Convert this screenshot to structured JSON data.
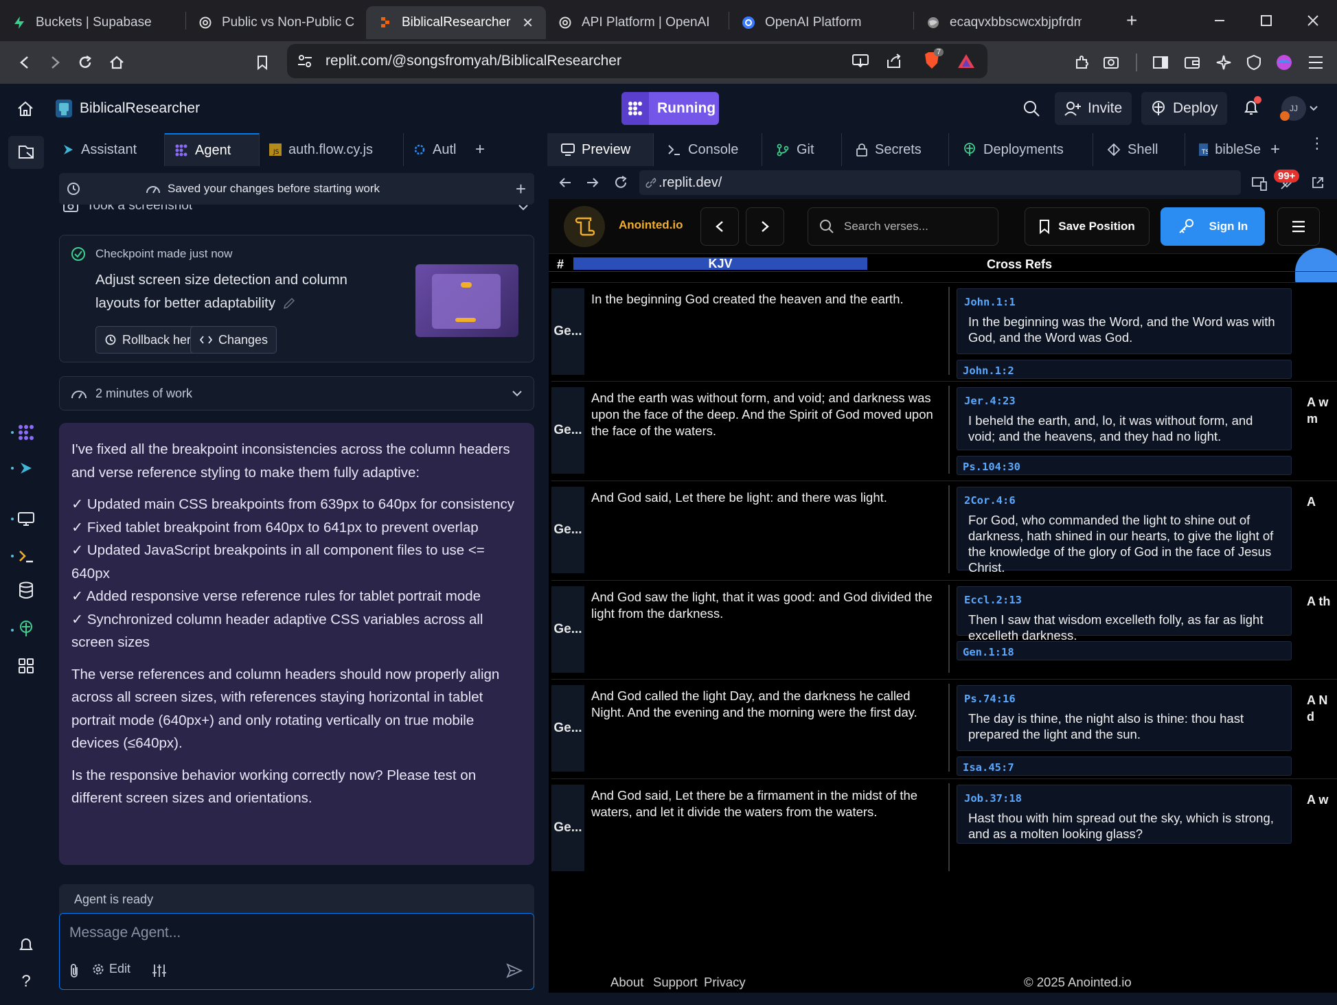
{
  "browser": {
    "tabs": [
      {
        "label": "Buckets | Supabase",
        "icon": "supabase-icon"
      },
      {
        "label": "Public vs Non-Public Cor",
        "icon": "openai-icon"
      },
      {
        "label": "BiblicalResearcher - ",
        "icon": "replit-icon",
        "active": true
      },
      {
        "label": "API Platform | OpenAI",
        "icon": "openai-icon"
      },
      {
        "label": "OpenAI Platform",
        "icon": "openai-platform-icon"
      },
      {
        "label": "ecaqvxbbscwcxbjpfrdm.s",
        "icon": "globe-icon"
      }
    ],
    "url": "replit.com/@songsfromyah/BiblicalResearcher",
    "shield_count": "7"
  },
  "replit": {
    "project_name": "BiblicalResearcher",
    "run_label": "Running",
    "invite_label": "Invite",
    "deploy_label": "Deploy",
    "avatar_initials": "JJ"
  },
  "left_pane": {
    "tabs": [
      {
        "label": "Assistant"
      },
      {
        "label": "Agent",
        "active": true
      },
      {
        "label": "auth.flow.cy.js"
      },
      {
        "label": "Autl"
      }
    ],
    "saved_bar": "Saved your changes before starting work",
    "screenshot_label": "Took a screenshot",
    "checkpoint": {
      "status": "Checkpoint made just now",
      "title_line1": "Adjust screen size detection and column",
      "title_line2": "layouts for better adaptability",
      "rollback_label": "Rollback here",
      "changes_label": "Changes"
    },
    "work_time": "2 minutes of work",
    "message": {
      "intro": "I've fixed all the breakpoint inconsistencies across the column headers and verse reference styling to make them fully adaptive:",
      "bullets": [
        "✓ Updated main CSS breakpoints from 639px to 640px for consistency",
        "✓ Fixed tablet breakpoint from 640px to 641px to prevent overlap",
        "✓ Updated JavaScript breakpoints in all component files to use <= 640px",
        "✓ Added responsive verse reference rules for tablet portrait mode",
        "✓ Synchronized column header adaptive CSS variables across all screen sizes"
      ],
      "para2": "The verse references and column headers should now properly align across all screen sizes, with references staying horizontal in tablet portrait mode (640px+) and only rotating vertically on true mobile devices (≤640px).",
      "para3": "Is the responsive behavior working correctly now? Please test on different screen sizes and orientations."
    },
    "agent_status": "Agent is ready",
    "composer_placeholder": "Message Agent...",
    "edit_label": "Edit"
  },
  "right_pane": {
    "tabs": [
      {
        "label": "Preview",
        "active": true
      },
      {
        "label": "Console"
      },
      {
        "label": "Git"
      },
      {
        "label": "Secrets"
      },
      {
        "label": "Deployments"
      },
      {
        "label": "Shell"
      },
      {
        "label": "bibleSe"
      }
    ],
    "preview_url": ".replit.dev/",
    "notification_badge": "99+"
  },
  "webapp": {
    "brand": "Anointed.io",
    "search_placeholder": "Search verses...",
    "save_position_label": "Save Position",
    "sign_in_label": "Sign In",
    "colors": {
      "accent": "#2b8cf2",
      "kjv_header": "#2a4fb8",
      "ref_link": "#5aa9ff",
      "brand": "#f2b02a"
    },
    "columns": {
      "num": "#",
      "kjv": "KJV",
      "xrefs": "Cross Refs"
    },
    "rows": [
      {
        "ref": "Ge...",
        "text": "In the beginning God created the heaven and the earth.",
        "xref": "John.1:1",
        "xref_text": "In the beginning was the Word, and the Word was with God, and the Word was God.",
        "next_ref": "John.1:2",
        "edge": ""
      },
      {
        "ref": "Ge...",
        "text": "And the earth was without form, and void; and darkness was upon the face of the deep. And the Spirit of God moved upon the face of the waters.",
        "xref": "Jer.4:23",
        "xref_text": "I beheld the earth, and, lo, it was without form, and void; and the heavens, and they had no light.",
        "next_ref": "Ps.104:30",
        "edge": "A w m"
      },
      {
        "ref": "Ge...",
        "text": "And God said, Let there be light: and there was light.",
        "xref": "2Cor.4:6",
        "xref_text": "For God, who commanded the light to shine out of darkness, hath shined in our hearts, to give the light of the knowledge of the glory of God in the face of Jesus Christ.",
        "next_ref": "",
        "edge": "A"
      },
      {
        "ref": "Ge...",
        "text": "And God saw the light, that it was good: and God divided the light from the darkness.",
        "xref": "Eccl.2:13",
        "xref_text": "Then I saw that wisdom excelleth folly, as far as light excelleth darkness.",
        "next_ref": "Gen.1:18",
        "edge": "A th"
      },
      {
        "ref": "Ge...",
        "text": "And God called the light Day, and the darkness he called Night. And the evening and the morning were the first day.",
        "xref": "Ps.74:16",
        "xref_text": "The day is thine, the night also is thine: thou hast prepared the light and the sun.",
        "next_ref": "Isa.45:7",
        "edge": "A N d"
      },
      {
        "ref": "Ge...",
        "text": "And God said, Let there be a firmament in the midst of the waters, and let it divide the waters from the waters.",
        "xref": "Job.37:18",
        "xref_text": "Hast thou with him spread out the sky, which is strong, and as a molten looking glass?",
        "next_ref": "",
        "edge": "A w"
      }
    ],
    "footer": {
      "about": "About",
      "support": "Support",
      "privacy": "Privacy",
      "copyright": "© 2025 Anointed.io"
    }
  }
}
